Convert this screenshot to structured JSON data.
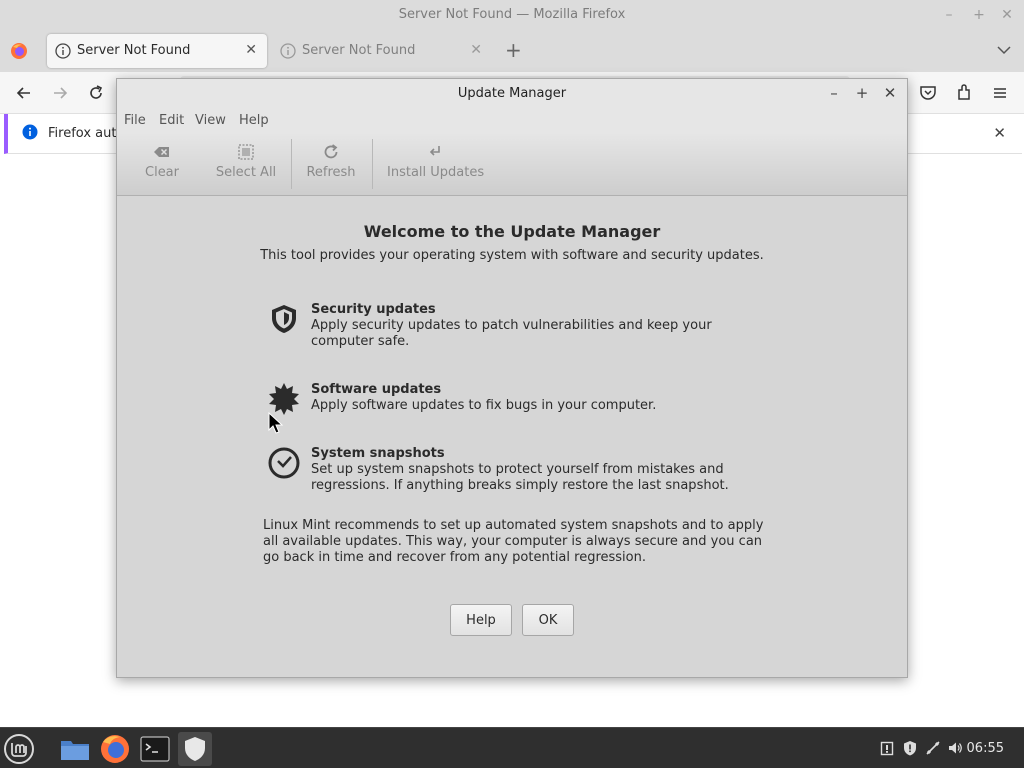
{
  "firefox": {
    "window_title": "Server Not Found — Mozilla Firefox",
    "tabs": [
      {
        "label": "Server Not Found",
        "active": true
      },
      {
        "label": "Server Not Found",
        "active": false
      }
    ],
    "notification_text": "Firefox auto"
  },
  "update_manager": {
    "title": "Update Manager",
    "menu": [
      "File",
      "Edit",
      "View",
      "Help"
    ],
    "toolbar": {
      "clear": "Clear",
      "select_all": "Select All",
      "refresh": "Refresh",
      "install_updates": "Install Updates"
    },
    "welcome_title": "Welcome to the Update Manager",
    "welcome_subtitle": "This tool provides your operating system with software and security updates.",
    "features": [
      {
        "icon": "shield-icon",
        "title": "Security updates",
        "description": "Apply security updates to patch vulnerabilities and keep your computer safe."
      },
      {
        "icon": "badge-icon",
        "title": "Software updates",
        "description": "Apply software updates to fix bugs in your computer."
      },
      {
        "icon": "clock-icon",
        "title": "System snapshots",
        "description": "Set up system snapshots to protect yourself from mistakes and regressions. If anything breaks simply restore the last snapshot."
      }
    ],
    "recommendation": "Linux Mint recommends to set up automated system snapshots and to apply all available updates. This way, your computer is always secure and you can go back in time and recover from any potential regression.",
    "buttons": {
      "help": "Help",
      "ok": "OK"
    }
  },
  "taskbar": {
    "clock": "06:55"
  },
  "colors": {
    "taskbar_bg": "#2f2f2f",
    "dialog_bg": "#d6d6d6",
    "notice_accent": "#9a5cff",
    "info_blue": "#0060df"
  }
}
